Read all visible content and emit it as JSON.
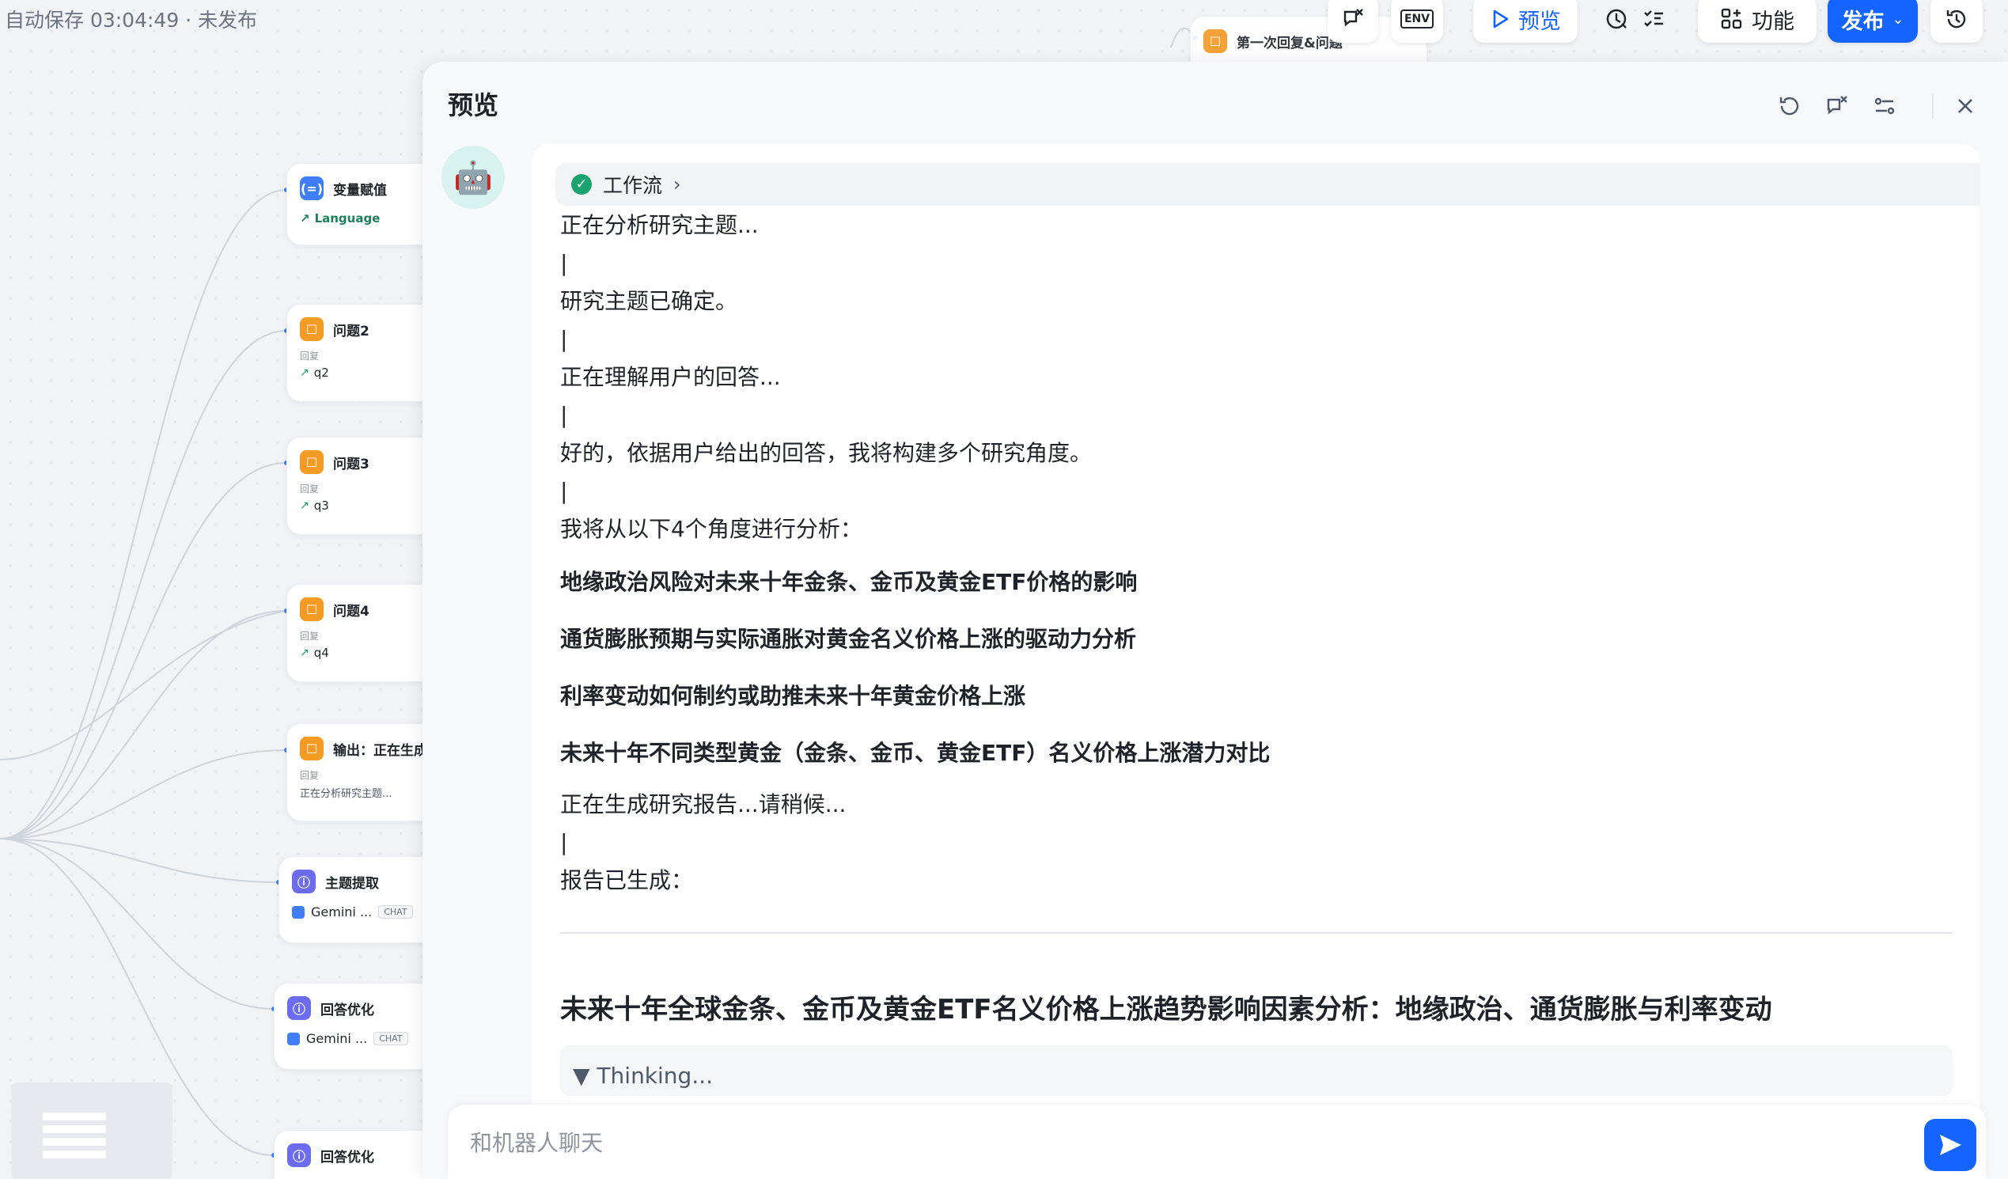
{
  "autosave": "自动保存 03:04:49 · 未发布",
  "toolbar": {
    "env_label": "ENV",
    "preview_label": "预览",
    "features_label": "功能",
    "publish_label": "发布"
  },
  "nodes": {
    "top": {
      "title": "第一次回复&问题"
    },
    "var_assign": {
      "title": "变量赋值",
      "value": "Language"
    },
    "q2": {
      "title": "问题2",
      "sub": "回复",
      "value": "q2"
    },
    "q3": {
      "title": "问题3",
      "sub": "回复",
      "value": "q3"
    },
    "q4": {
      "title": "问题4",
      "sub": "回复",
      "value": "q4"
    },
    "output": {
      "title": "输出：正在生成",
      "sub": "回复",
      "value": "正在分析研究主题..."
    },
    "topic": {
      "title": "主题提取",
      "model": "Gemini ...",
      "chat": "CHAT"
    },
    "refine1": {
      "title": "回答优化",
      "model": "Gemini ...",
      "chat": "CHAT"
    },
    "refine2": {
      "title": "回答优化"
    }
  },
  "panel": {
    "title": "预览",
    "workflow_label": "工作流",
    "lines": {
      "l1": "正在分析研究主题...",
      "l2": "研究主题已确定。",
      "l3": "正在理解用户的回答...",
      "l4": "好的，依据用户给出的回答，我将构建多个研究角度。",
      "l5": "我将从以下4个角度进行分析：",
      "l6": "正在生成研究报告...请稍候...",
      "l7": "报告已生成：",
      "cursor": "|"
    },
    "angles": [
      "地缘政治风险对未来十年金条、金币及黄金ETF价格的影响",
      "通货膨胀预期与实际通胀对黄金名义价格上涨的驱动力分析",
      "利率变动如何制约或助推未来十年黄金价格上涨",
      "未来十年不同类型黄金（金条、金币、黄金ETF）名义价格上涨潜力对比"
    ],
    "report_title": "未来十年全球金条、金币及黄金ETF名义价格上涨趋势影响因素分析：地缘政治、通货膨胀与利率变动",
    "thinking": "▼ Thinking...",
    "input_placeholder": "和机器人聊天"
  }
}
